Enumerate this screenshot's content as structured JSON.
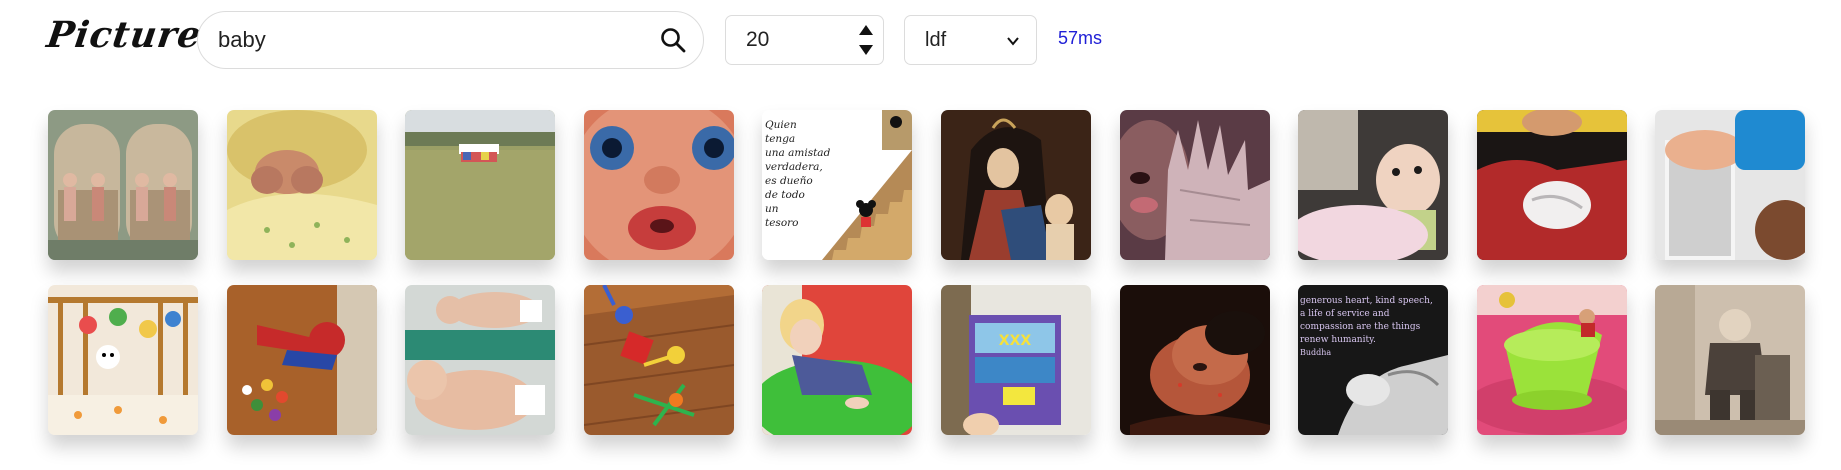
{
  "header": {
    "logo_text": "Pictures",
    "search": {
      "value": "baby",
      "icon": "search-icon"
    },
    "count_input": {
      "value": "20"
    },
    "mode_select": {
      "value": "ldf"
    },
    "timing": "57ms"
  },
  "results": [
    {
      "name": "vintage-stereo-children-photo"
    },
    {
      "name": "baby-feet-on-yellow-blanket"
    },
    {
      "name": "park-field-with-group"
    },
    {
      "name": "doll-face-closeup"
    },
    {
      "name": "quote-card-stairs-cartoon",
      "text_lines": [
        "Quien",
        "tenga",
        "una amistad",
        "verdadera,",
        "es dueño",
        "de todo",
        "un",
        "tesoro"
      ]
    },
    {
      "name": "madonna-and-child-painting"
    },
    {
      "name": "hand-in-front-of-face"
    },
    {
      "name": "baby-in-pink-blanket"
    },
    {
      "name": "baby-held-in-red-sweater"
    },
    {
      "name": "baby-by-window"
    },
    {
      "name": "crib-with-toys"
    },
    {
      "name": "spiderman-toy-with-candy"
    },
    {
      "name": "two-babies-on-table"
    },
    {
      "name": "construction-toy-on-floor"
    },
    {
      "name": "toddler-on-green-mat"
    },
    {
      "name": "hand-holding-dvd-case"
    },
    {
      "name": "child-face-in-shadow"
    },
    {
      "name": "quote-hands-black-white",
      "text_lines": [
        "generous heart, kind speech,",
        "a life of service and",
        "compassion are the things",
        "renew humanity.",
        "Buddha"
      ]
    },
    {
      "name": "teacup-ride"
    },
    {
      "name": "old-photo-seated-child"
    }
  ]
}
